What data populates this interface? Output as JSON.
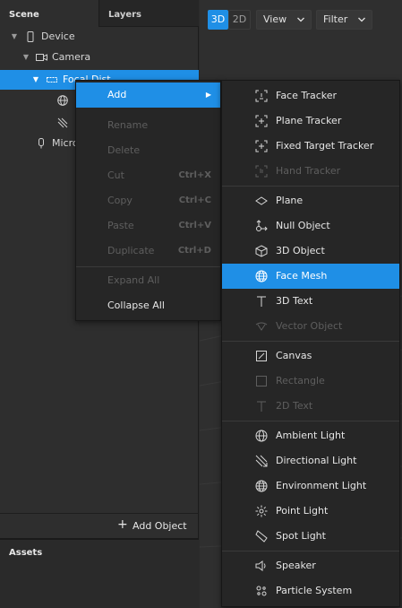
{
  "tabs": {
    "scene": "Scene",
    "layers": "Layers"
  },
  "scene_tree": [
    {
      "label": "Device",
      "icon": "phone-icon"
    },
    {
      "label": "Camera",
      "icon": "camera-icon"
    },
    {
      "label": "Focal Dist",
      "icon": "focal-distance-icon",
      "selected": true
    },
    {
      "label": "",
      "icon": "globe-icon"
    },
    {
      "label": "",
      "icon": "directional-light-icon"
    },
    {
      "label": "Micro",
      "icon": "microphone-icon"
    }
  ],
  "panel": {
    "add_object": "Add Object",
    "assets": "Assets"
  },
  "viewport_toolbar": {
    "mode_3d": "3D",
    "mode_2d": "2D",
    "view": "View",
    "filter": "Filter"
  },
  "context_menu": {
    "add": "Add",
    "rename": "Rename",
    "delete": "Delete",
    "cut": "Cut",
    "cut_key": "Ctrl+X",
    "copy": "Copy",
    "copy_key": "Ctrl+C",
    "paste": "Paste",
    "paste_key": "Ctrl+V",
    "duplicate": "Duplicate",
    "duplicate_key": "Ctrl+D",
    "expand_all": "Expand All",
    "collapse_all": "Collapse All"
  },
  "add_submenu": [
    {
      "label": "Face Tracker",
      "icon": "face-tracker-icon",
      "enabled": true
    },
    {
      "label": "Plane Tracker",
      "icon": "plane-tracker-icon",
      "enabled": true
    },
    {
      "label": "Fixed Target Tracker",
      "icon": "target-tracker-icon",
      "enabled": true
    },
    {
      "label": "Hand Tracker",
      "icon": "hand-tracker-icon",
      "enabled": false
    },
    {
      "label": "Plane",
      "icon": "plane-icon",
      "enabled": true
    },
    {
      "label": "Null Object",
      "icon": "null-object-icon",
      "enabled": true
    },
    {
      "label": "3D Object",
      "icon": "cube-icon",
      "enabled": true
    },
    {
      "label": "Face Mesh",
      "icon": "face-mesh-icon",
      "enabled": true,
      "highlighted": true
    },
    {
      "label": "3D Text",
      "icon": "text-icon",
      "enabled": true
    },
    {
      "label": "Vector Object",
      "icon": "vector-icon",
      "enabled": false
    },
    {
      "label": "Canvas",
      "icon": "canvas-icon",
      "enabled": true
    },
    {
      "label": "Rectangle",
      "icon": "rectangle-icon",
      "enabled": false
    },
    {
      "label": "2D Text",
      "icon": "text-2d-icon",
      "enabled": false
    },
    {
      "label": "Ambient Light",
      "icon": "ambient-light-icon",
      "enabled": true
    },
    {
      "label": "Directional Light",
      "icon": "directional-light-icon",
      "enabled": true
    },
    {
      "label": "Environment Light",
      "icon": "environment-light-icon",
      "enabled": true
    },
    {
      "label": "Point Light",
      "icon": "point-light-icon",
      "enabled": true
    },
    {
      "label": "Spot Light",
      "icon": "spot-light-icon",
      "enabled": true
    },
    {
      "label": "Speaker",
      "icon": "speaker-icon",
      "enabled": true
    },
    {
      "label": "Particle System",
      "icon": "particle-system-icon",
      "enabled": true
    }
  ],
  "colors": {
    "accent": "#1f8fe6",
    "panel": "#2e2e2e",
    "menu": "#262626",
    "disabled_text": "#5e5e5e"
  }
}
